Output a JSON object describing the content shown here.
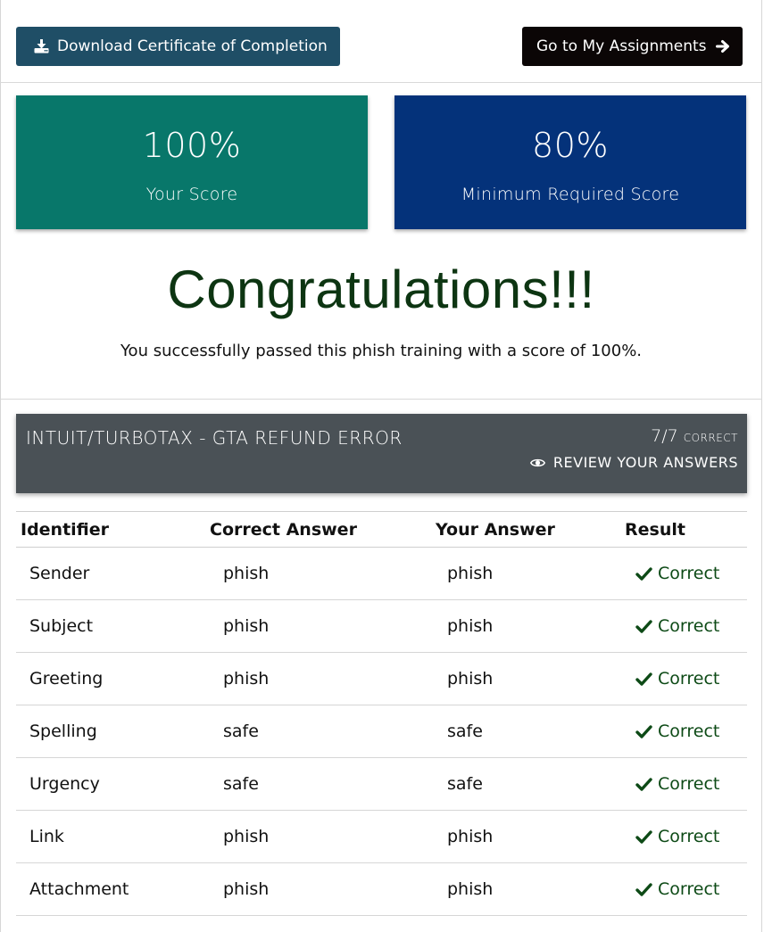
{
  "actions": {
    "download_label": "Download Certificate of Completion",
    "assignments_label": "Go to My Assignments",
    "download_icon": "download-icon",
    "assignments_icon": "arrow-right-icon"
  },
  "scores": {
    "your_score_value": "100%",
    "your_score_label": "Your Score",
    "min_score_value": "80%",
    "min_score_label": "Minimum Required Score"
  },
  "result": {
    "heading": "Congratulations!!!",
    "message": "You successfully passed this phish training with a score of 100%."
  },
  "training": {
    "title": "INTUIT/TURBOTAX - GTA REFUND ERROR",
    "count": "7/7",
    "count_label": "CORRECT",
    "review_label": "REVIEW YOUR ANSWERS",
    "review_icon": "eye-icon"
  },
  "table": {
    "headers": [
      "Identifier",
      "Correct Answer",
      "Your Answer",
      "Result"
    ],
    "rows": [
      {
        "identifier": "Sender",
        "correct": "phish",
        "yours": "phish",
        "result": "Correct"
      },
      {
        "identifier": "Subject",
        "correct": "phish",
        "yours": "phish",
        "result": "Correct"
      },
      {
        "identifier": "Greeting",
        "correct": "phish",
        "yours": "phish",
        "result": "Correct"
      },
      {
        "identifier": "Spelling",
        "correct": "safe",
        "yours": "safe",
        "result": "Correct"
      },
      {
        "identifier": "Urgency",
        "correct": "safe",
        "yours": "safe",
        "result": "Correct"
      },
      {
        "identifier": "Link",
        "correct": "phish",
        "yours": "phish",
        "result": "Correct"
      },
      {
        "identifier": "Attachment",
        "correct": "phish",
        "yours": "phish",
        "result": "Correct"
      }
    ],
    "result_icon": "check-icon"
  },
  "colors": {
    "download_button": "#1f4e66",
    "assignments_button": "#0b0606",
    "your_score_card": "#08776a",
    "min_score_card": "#04327a",
    "congrats_text": "#0d3512",
    "training_header": "#4a5156",
    "correct_text": "#0d4a16"
  }
}
